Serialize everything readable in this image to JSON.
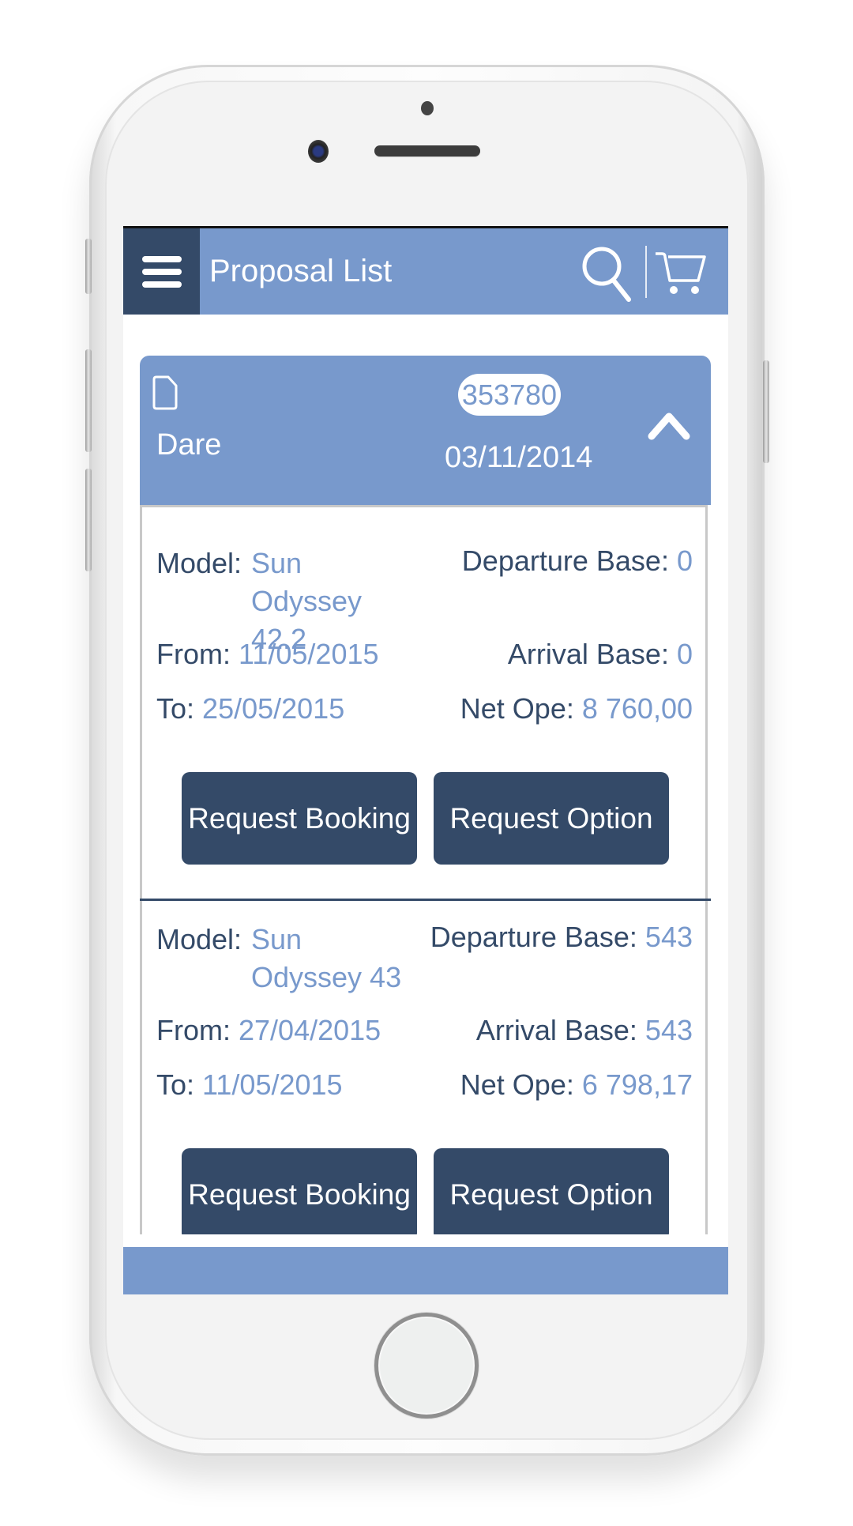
{
  "header": {
    "title": "Proposal List",
    "icons": [
      "menu-icon",
      "search-icon",
      "cart-icon"
    ]
  },
  "colors": {
    "primary": "#7899cc",
    "dark": "#344a68",
    "value_text": "#7899cc",
    "label_text": "#344a68"
  },
  "proposal": {
    "client": "Dare",
    "reference": "353780",
    "date": "03/11/2014",
    "expanded": true,
    "items": [
      {
        "model_label": "Model:",
        "model": "Sun Odyssey 42.2",
        "departure_label": "Departure Base:",
        "departure": "0",
        "from_label": "From:",
        "from": "11/05/2015",
        "arrival_label": "Arrival Base:",
        "arrival": "0",
        "to_label": "To:",
        "to": "25/05/2015",
        "net_label": "Net Ope:",
        "net": "8 760,00",
        "booking_button": "Request Booking",
        "option_button": "Request Option"
      },
      {
        "model_label": "Model:",
        "model": "Sun Odyssey 43",
        "departure_label": "Departure Base:",
        "departure": "543",
        "from_label": "From:",
        "from": "27/04/2015",
        "arrival_label": "Arrival Base:",
        "arrival": "543",
        "to_label": "To:",
        "to": "11/05/2015",
        "net_label": "Net Ope:",
        "net": "6 798,17",
        "booking_button": "Request Booking",
        "option_button": "Request Option"
      }
    ]
  }
}
